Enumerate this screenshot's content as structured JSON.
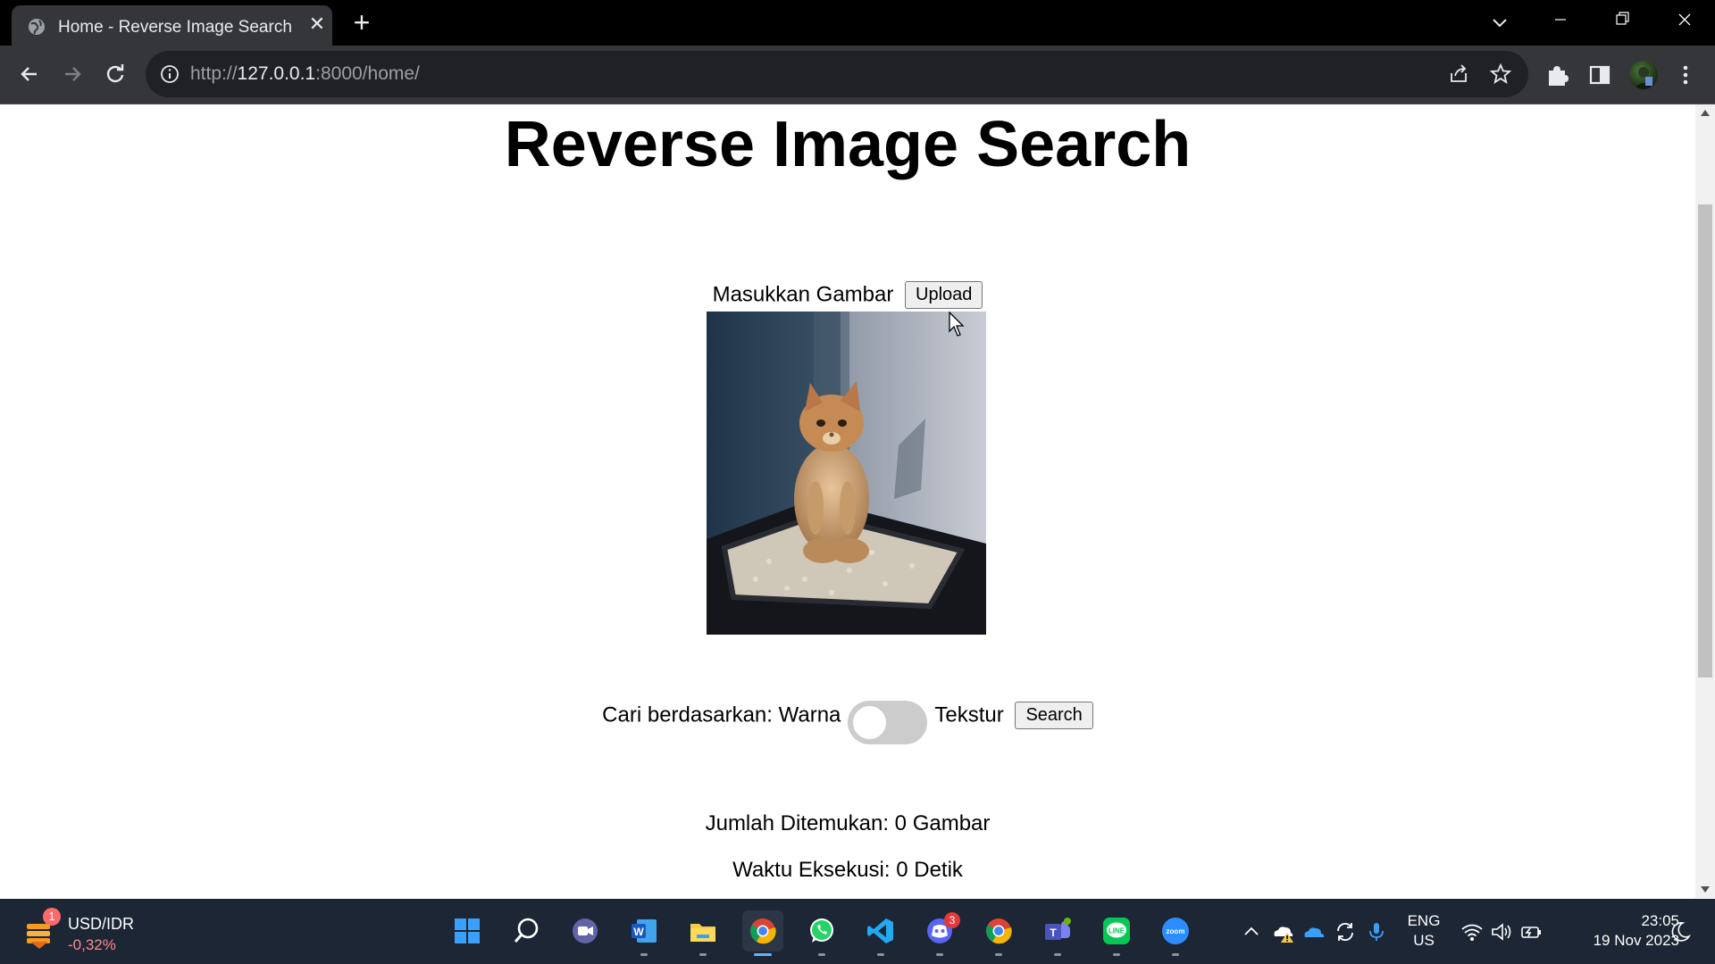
{
  "browser": {
    "tab_title": "Home - Reverse Image Search",
    "url_scheme": "http://",
    "url_host": "127.0.0.1",
    "url_rest": ":8000/home/"
  },
  "page": {
    "title": "Reverse Image Search",
    "upload_label": "Masukkan Gambar",
    "upload_button": "Upload",
    "search_by_label": "Cari berdasarkan: Warna",
    "toggle_right_label": "Tekstur",
    "toggle_state": "off",
    "search_button": "Search",
    "result_count": "Jumlah Ditemukan: 0 Gambar",
    "exec_time": "Waktu Eksekusi: 0 Detik"
  },
  "taskbar": {
    "widget_badge": "1",
    "widget_title": "USD/IDR",
    "widget_sub": "-0,32%",
    "discord_badge": "3",
    "lang_1": "ENG",
    "lang_2": "US",
    "time": "23:05",
    "date": "19 Nov 2023"
  },
  "colors": {
    "accent": "#5fb4ff",
    "toggle_off": "#cccccc"
  }
}
